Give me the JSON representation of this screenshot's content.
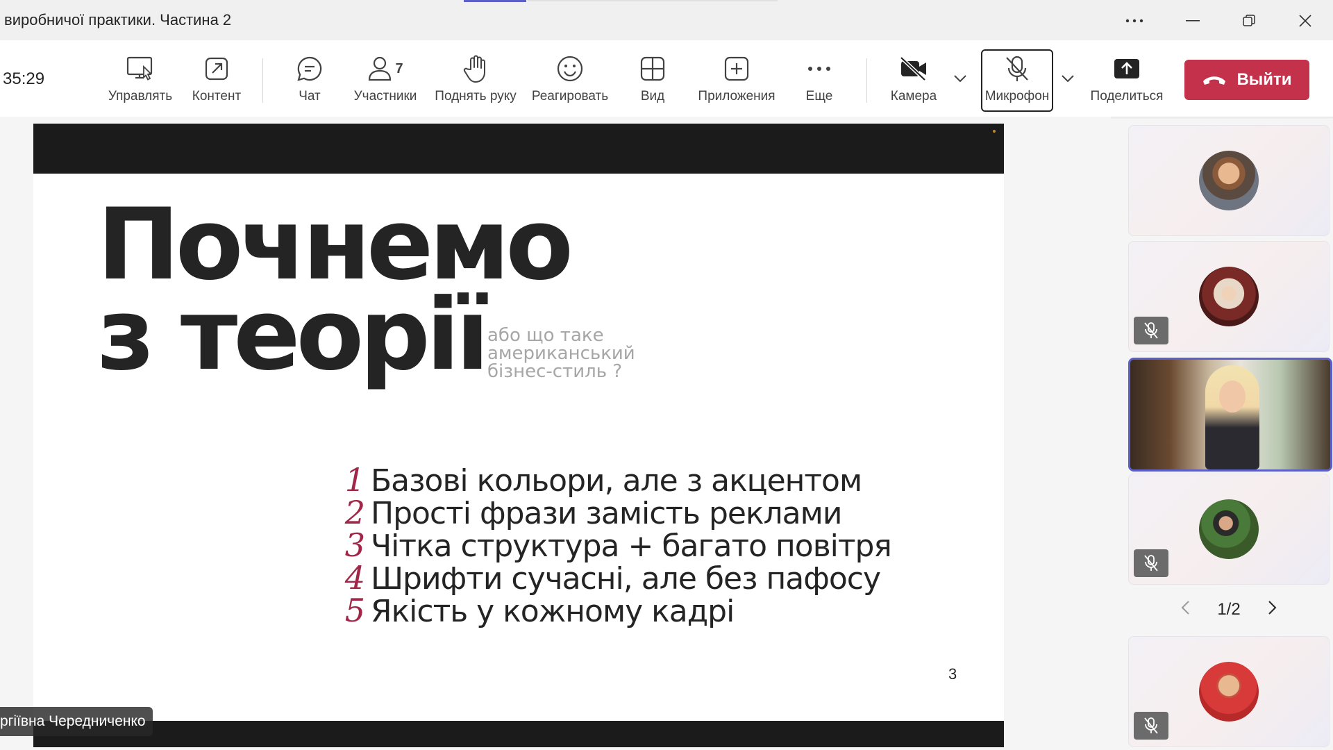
{
  "window": {
    "title": "виробничої практики. Частина 2"
  },
  "toolbar": {
    "timer": "35:29",
    "items": [
      {
        "label": "Управлять"
      },
      {
        "label": "Контент"
      },
      {
        "label": "Чат"
      },
      {
        "label": "Участники",
        "count": "7"
      },
      {
        "label": "Поднять руку"
      },
      {
        "label": "Реагировать"
      },
      {
        "label": "Вид"
      },
      {
        "label": "Приложения"
      },
      {
        "label": "Еще"
      },
      {
        "label": "Камера"
      },
      {
        "label": "Микрофон"
      },
      {
        "label": "Поделиться"
      }
    ],
    "leave_label": "Выйти",
    "leave_color": "#c4314b",
    "accent_color": "#5b5fc7"
  },
  "slide": {
    "headline_line1": "Почнемо",
    "headline_line2": "з теорії",
    "subtitle_line1": "або що таке",
    "subtitle_line2": "американський",
    "subtitle_line3": "бізнес-стиль ?",
    "list": [
      {
        "num": "1",
        "text": "Базові кольори, але з акцентом"
      },
      {
        "num": "2",
        "text": "Прості фрази замість реклами"
      },
      {
        "num": "3",
        "text": "Чітка структура + багато повітря"
      },
      {
        "num": "4",
        "text": "Шрифти сучасні, але без пафосу"
      },
      {
        "num": "5",
        "text": "Якість у кожному кадрі"
      }
    ],
    "page_number": "3",
    "number_color": "#a02747"
  },
  "presenter_name": "ргіївна Чередниченко",
  "participants": {
    "pager": "1/2"
  }
}
